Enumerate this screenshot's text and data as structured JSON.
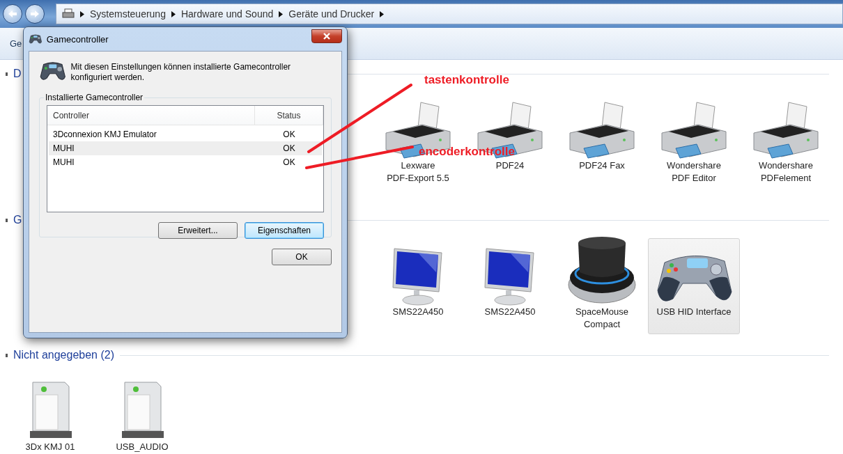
{
  "address_bar": {
    "breadcrumbs": [
      "Systemsteuerung",
      "Hardware und Sound",
      "Geräte und Drucker"
    ]
  },
  "toolbar": {
    "items": [
      "Ge"
    ]
  },
  "sections": [
    {
      "title": "D",
      "devices": [
        {
          "kind": "printer",
          "lines": [
            "Lexware",
            "PDF-Export 5.5"
          ],
          "selected": false
        },
        {
          "kind": "printer",
          "lines": [
            "PDF24"
          ],
          "selected": false
        },
        {
          "kind": "printer",
          "lines": [
            "PDF24 Fax"
          ],
          "selected": false
        },
        {
          "kind": "printer",
          "lines": [
            "Wondershare",
            "PDF Editor"
          ],
          "selected": false
        },
        {
          "kind": "printer",
          "lines": [
            "Wondershare",
            "PDFelement"
          ],
          "selected": false
        }
      ]
    },
    {
      "title": "G",
      "devices": [
        {
          "kind": "monitor",
          "lines": [
            "SMS22A450"
          ],
          "selected": false
        },
        {
          "kind": "monitor",
          "lines": [
            "SMS22A450"
          ],
          "selected": false
        },
        {
          "kind": "spacemouse",
          "lines": [
            "SpaceMouse",
            "Compact"
          ],
          "selected": false
        },
        {
          "kind": "gamepad",
          "lines": [
            "USB HID Interface"
          ],
          "selected": true
        }
      ]
    },
    {
      "title": "Nicht angegeben (2)",
      "devices": [
        {
          "kind": "tower",
          "lines": [
            "3Dx KMJ 01"
          ],
          "selected": false
        },
        {
          "kind": "tower",
          "lines": [
            "USB_AUDIO"
          ],
          "selected": false
        }
      ]
    }
  ],
  "dialog": {
    "title": "Gamecontroller",
    "description": "Mit diesen Einstellungen können installierte Gamecontroller konfiguriert werden.",
    "group_title": "Installierte Gamecontroller",
    "columns": [
      "Controller",
      "Status"
    ],
    "rows": [
      {
        "controller": "3Dconnexion KMJ Emulator",
        "status": "OK",
        "selected": false
      },
      {
        "controller": "MUHI",
        "status": "OK",
        "selected": true
      },
      {
        "controller": "MUHI",
        "status": "OK",
        "selected": false
      }
    ],
    "buttons": [
      {
        "label": "Erweitert...",
        "default": false
      },
      {
        "label": "Eigenschaften",
        "default": true
      }
    ],
    "ok_button": "OK"
  },
  "annotations": [
    {
      "text": "tastenkontrolle"
    },
    {
      "text": "encoderkontrolle"
    }
  ]
}
